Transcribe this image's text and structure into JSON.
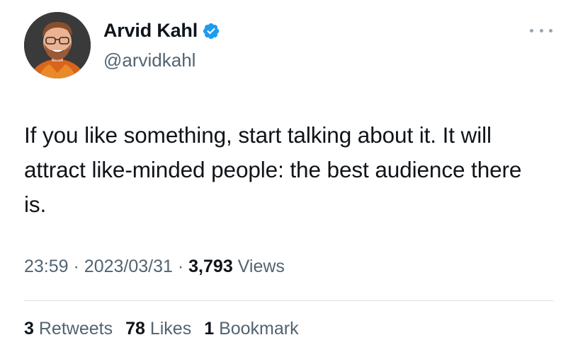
{
  "author": {
    "display_name": "Arvid Kahl",
    "handle": "@arvidkahl",
    "verified_icon": "verified-badge-icon",
    "verified_color": "#1d9bf0"
  },
  "tweet": {
    "text": "If you like something, start talking about it. It will attract like-minded people: the best audience there is.",
    "time": "23:59",
    "separator": "·",
    "date": "2023/03/31",
    "views_count": "3,793",
    "views_label": "Views"
  },
  "stats": {
    "retweets_count": "3",
    "retweets_label": "Retweets",
    "likes_count": "78",
    "likes_label": "Likes",
    "bookmarks_count": "1",
    "bookmarks_label": "Bookmark"
  },
  "colors": {
    "text_primary": "#0f1419",
    "text_secondary": "#536471",
    "divider": "#dfe3e7"
  }
}
